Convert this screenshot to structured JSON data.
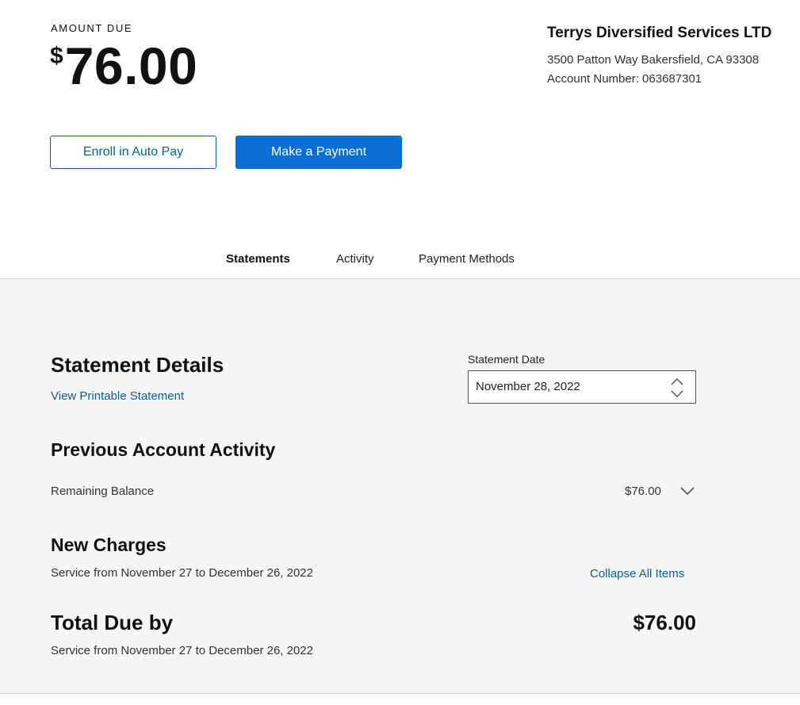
{
  "header": {
    "amount_label": "AMOUNT DUE",
    "currency_symbol": "$",
    "amount_value": "76.00"
  },
  "company": {
    "name": "Terrys Diversified Services LTD",
    "address": "3500 Patton Way Bakersfield, CA 93308",
    "account": "Account Number: 063687301"
  },
  "actions": {
    "autopay_label": "Enroll in Auto Pay",
    "payment_label": "Make a Payment"
  },
  "tabs": [
    {
      "label": "Statements",
      "active": true
    },
    {
      "label": "Activity",
      "active": false
    },
    {
      "label": "Payment Methods",
      "active": false
    }
  ],
  "statement": {
    "title": "Statement Details",
    "printable_link": "View Printable Statement",
    "date_label": "Statement Date",
    "date_value": "November 28, 2022"
  },
  "previous_activity": {
    "title": "Previous Account Activity",
    "remaining_label": "Remaining Balance",
    "remaining_amount": "$76.00"
  },
  "new_charges": {
    "title": "New Charges",
    "service_period": "Service from November 27 to December 26, 2022",
    "collapse_link": "Collapse All Items"
  },
  "total": {
    "title": "Total Due by",
    "amount": "$76.00",
    "service_period": "Service from November 27 to December 26, 2022"
  },
  "colors": {
    "primary": "#0a6fd4",
    "link": "#0b5e9e",
    "panel_bg": "#f5f5f5"
  }
}
